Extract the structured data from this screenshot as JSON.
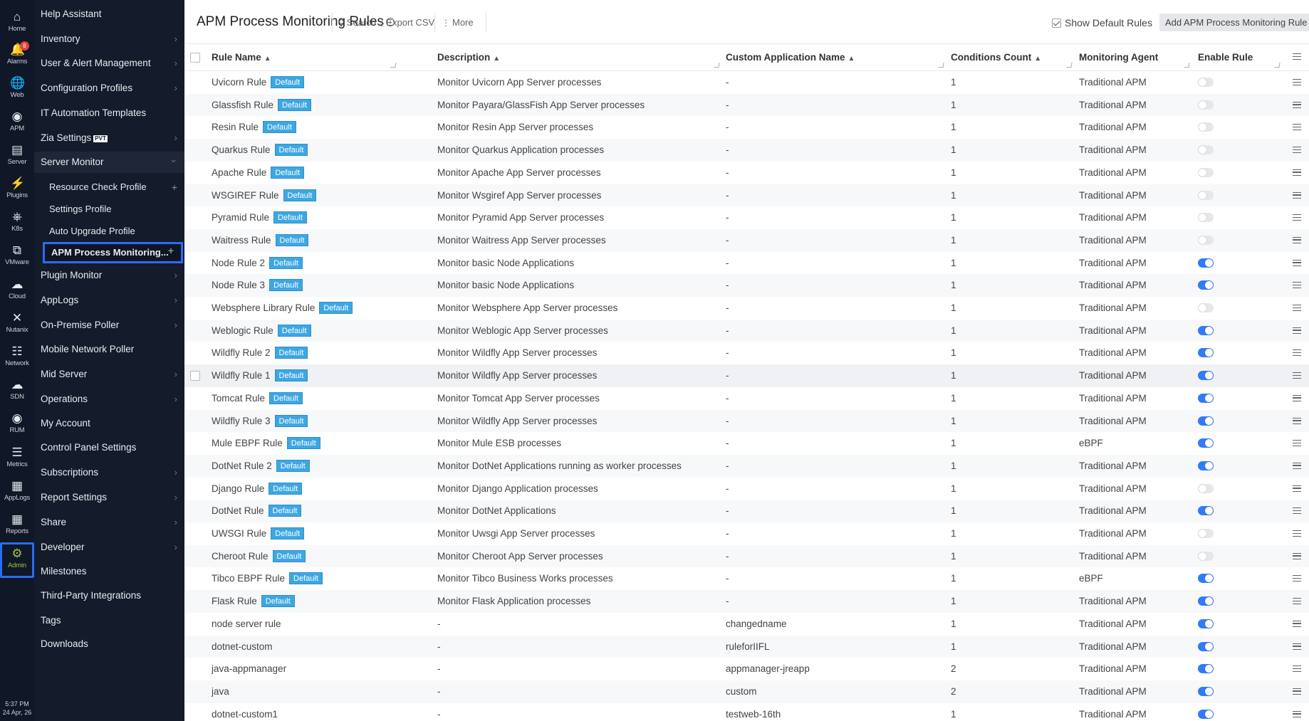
{
  "rail": {
    "items": [
      {
        "label": "Home",
        "icon": "home-icon"
      },
      {
        "label": "Alarms",
        "icon": "bell-icon",
        "badge": "8"
      },
      {
        "label": "Web",
        "icon": "globe-icon"
      },
      {
        "label": "APM",
        "icon": "binoculars-icon"
      },
      {
        "label": "Server",
        "icon": "server-icon"
      },
      {
        "label": "Plugins",
        "icon": "plug-icon"
      },
      {
        "label": "K8s",
        "icon": "helm-icon"
      },
      {
        "label": "VMware",
        "icon": "vmware-icon"
      },
      {
        "label": "Cloud",
        "icon": "cloud-icon"
      },
      {
        "label": "Nutanix",
        "icon": "nutanix-icon"
      },
      {
        "label": "Network",
        "icon": "network-icon"
      },
      {
        "label": "SDN",
        "icon": "sdn-icon"
      },
      {
        "label": "RUM",
        "icon": "rum-icon"
      },
      {
        "label": "Metrics",
        "icon": "metrics-icon"
      },
      {
        "label": "AppLogs",
        "icon": "applogs-icon"
      },
      {
        "label": "Reports",
        "icon": "reports-icon"
      },
      {
        "label": "Admin",
        "icon": "gear-icon"
      }
    ],
    "clock_time": "5:37 PM",
    "clock_date": "24 Apr, 26"
  },
  "menu": {
    "items": [
      {
        "label": "Help Assistant",
        "chevron": false
      },
      {
        "label": "Inventory",
        "chevron": true
      },
      {
        "label": "User & Alert Management",
        "chevron": true
      },
      {
        "label": "Configuration Profiles",
        "chevron": true
      },
      {
        "label": "IT Automation Templates",
        "chevron": false
      },
      {
        "label": "Zia Settings",
        "chevron": true,
        "tag": "PVT"
      },
      {
        "label": "Server Monitor",
        "chevron": true,
        "expanded": true
      },
      {
        "label": "Resource Check Profile",
        "sub": true,
        "plus": true
      },
      {
        "label": "Settings Profile",
        "sub": true
      },
      {
        "label": "Auto Upgrade Profile",
        "sub": true
      },
      {
        "label": "APM Process Monitoring...",
        "sub": true,
        "plus": true,
        "active": true
      },
      {
        "label": "Plugin Monitor",
        "chevron": true
      },
      {
        "label": "AppLogs",
        "chevron": true
      },
      {
        "label": "On-Premise Poller",
        "chevron": true
      },
      {
        "label": "Mobile Network Poller",
        "chevron": false
      },
      {
        "label": "Mid Server",
        "chevron": true
      },
      {
        "label": "Operations",
        "chevron": true
      },
      {
        "label": "My Account",
        "chevron": false
      },
      {
        "label": "Control Panel Settings",
        "chevron": false
      },
      {
        "label": "Subscriptions",
        "chevron": true
      },
      {
        "label": "Report Settings",
        "chevron": true
      },
      {
        "label": "Share",
        "chevron": true
      },
      {
        "label": "Developer",
        "chevron": true
      },
      {
        "label": "Milestones",
        "chevron": false
      },
      {
        "label": "Third-Party Integrations",
        "chevron": false
      },
      {
        "label": "Tags",
        "chevron": false
      },
      {
        "label": "Downloads",
        "chevron": false
      }
    ]
  },
  "header": {
    "title": "APM Process Monitoring Rules",
    "search": "Search",
    "export": "Export CSV",
    "more": "More",
    "show_default": "Show Default Rules",
    "add_rule": "Add APM Process Monitoring Rule"
  },
  "table": {
    "columns": [
      "Rule Name",
      "Description",
      "Custom Application Name",
      "Conditions Count",
      "Monitoring Agent",
      "Enable Rule"
    ],
    "default_badge": "Default",
    "rows": [
      {
        "name": "Uvicorn Rule",
        "default": true,
        "description": "Monitor Uvicorn App Server processes",
        "custom": "-",
        "count": "1",
        "agent": "Traditional APM",
        "enabled": false
      },
      {
        "name": "Glassfish Rule",
        "default": true,
        "description": "Monitor Payara/GlassFish App Server processes",
        "custom": "-",
        "count": "1",
        "agent": "Traditional APM",
        "enabled": false
      },
      {
        "name": "Resin Rule",
        "default": true,
        "description": "Monitor Resin App Server processes",
        "custom": "-",
        "count": "1",
        "agent": "Traditional APM",
        "enabled": false
      },
      {
        "name": "Quarkus Rule",
        "default": true,
        "description": "Monitor Quarkus Application processes",
        "custom": "-",
        "count": "1",
        "agent": "Traditional APM",
        "enabled": false
      },
      {
        "name": "Apache Rule",
        "default": true,
        "description": "Monitor Apache App Server processes",
        "custom": "-",
        "count": "1",
        "agent": "Traditional APM",
        "enabled": false
      },
      {
        "name": "WSGIREF Rule",
        "default": true,
        "description": "Monitor Wsgiref App Server processes",
        "custom": "-",
        "count": "1",
        "agent": "Traditional APM",
        "enabled": false
      },
      {
        "name": "Pyramid Rule",
        "default": true,
        "description": "Monitor Pyramid App Server processes",
        "custom": "-",
        "count": "1",
        "agent": "Traditional APM",
        "enabled": false
      },
      {
        "name": "Waitress Rule",
        "default": true,
        "description": "Monitor Waitress App Server processes",
        "custom": "-",
        "count": "1",
        "agent": "Traditional APM",
        "enabled": false
      },
      {
        "name": "Node Rule 2",
        "default": true,
        "description": "Monitor basic Node Applications",
        "custom": "-",
        "count": "1",
        "agent": "Traditional APM",
        "enabled": true
      },
      {
        "name": "Node Rule 3",
        "default": true,
        "description": "Monitor basic Node Applications",
        "custom": "-",
        "count": "1",
        "agent": "Traditional APM",
        "enabled": true
      },
      {
        "name": "Websphere Library Rule",
        "default": true,
        "description": "Monitor Websphere App Server processes",
        "custom": "-",
        "count": "1",
        "agent": "Traditional APM",
        "enabled": false
      },
      {
        "name": "Weblogic Rule",
        "default": true,
        "description": "Monitor Weblogic App Server processes",
        "custom": "-",
        "count": "1",
        "agent": "Traditional APM",
        "enabled": true
      },
      {
        "name": "Wildfly Rule 2",
        "default": true,
        "description": "Monitor Wildfly App Server processes",
        "custom": "-",
        "count": "1",
        "agent": "Traditional APM",
        "enabled": true
      },
      {
        "name": "Wildfly Rule 1",
        "default": true,
        "description": "Monitor Wildfly App Server processes",
        "custom": "-",
        "count": "1",
        "agent": "Traditional APM",
        "enabled": true,
        "hover": true
      },
      {
        "name": "Tomcat Rule",
        "default": true,
        "description": "Monitor Tomcat App Server processes",
        "custom": "-",
        "count": "1",
        "agent": "Traditional APM",
        "enabled": true
      },
      {
        "name": "Wildfly Rule 3",
        "default": true,
        "description": "Monitor Wildfly App Server processes",
        "custom": "-",
        "count": "1",
        "agent": "Traditional APM",
        "enabled": true
      },
      {
        "name": "Mule EBPF Rule",
        "default": true,
        "description": "Monitor Mule ESB processes",
        "custom": "-",
        "count": "1",
        "agent": "eBPF",
        "enabled": true
      },
      {
        "name": "DotNet Rule 2",
        "default": true,
        "description": "Monitor DotNet Applications running as worker processes",
        "custom": "-",
        "count": "1",
        "agent": "Traditional APM",
        "enabled": true
      },
      {
        "name": "Django Rule",
        "default": true,
        "description": "Monitor Django Application processes",
        "custom": "-",
        "count": "1",
        "agent": "Traditional APM",
        "enabled": false
      },
      {
        "name": "DotNet Rule",
        "default": true,
        "description": "Monitor DotNet Applications",
        "custom": "-",
        "count": "1",
        "agent": "Traditional APM",
        "enabled": true
      },
      {
        "name": "UWSGI Rule",
        "default": true,
        "description": "Monitor Uwsgi App Server processes",
        "custom": "-",
        "count": "1",
        "agent": "Traditional APM",
        "enabled": false
      },
      {
        "name": "Cheroot Rule",
        "default": true,
        "description": "Monitor Cheroot App Server processes",
        "custom": "-",
        "count": "1",
        "agent": "Traditional APM",
        "enabled": false
      },
      {
        "name": "Tibco EBPF Rule",
        "default": true,
        "description": "Monitor Tibco Business Works processes",
        "custom": "-",
        "count": "1",
        "agent": "eBPF",
        "enabled": true
      },
      {
        "name": "Flask Rule",
        "default": true,
        "description": "Monitor Flask Application processes",
        "custom": "-",
        "count": "1",
        "agent": "Traditional APM",
        "enabled": true
      },
      {
        "name": "node server rule",
        "default": false,
        "description": "-",
        "custom": "changedname",
        "count": "1",
        "agent": "Traditional APM",
        "enabled": true
      },
      {
        "name": "dotnet-custom",
        "default": false,
        "description": "-",
        "custom": "ruleforIIFL",
        "count": "1",
        "agent": "Traditional APM",
        "enabled": true
      },
      {
        "name": "java-appmanager",
        "default": false,
        "description": "-",
        "custom": "appmanager-jreapp",
        "count": "2",
        "agent": "Traditional APM",
        "enabled": true
      },
      {
        "name": "java",
        "default": false,
        "description": "-",
        "custom": "custom",
        "count": "2",
        "agent": "Traditional APM",
        "enabled": true
      },
      {
        "name": "dotnet-custom1",
        "default": false,
        "description": "-",
        "custom": "testweb-16th",
        "count": "1",
        "agent": "Traditional APM",
        "enabled": true
      }
    ]
  },
  "colors": {
    "rail_bg": "#101726",
    "menu_bg": "#141b2b",
    "accent": "#2a6df4",
    "badge": "#3ea7e3",
    "toggle_on": "#2f7cf6"
  }
}
